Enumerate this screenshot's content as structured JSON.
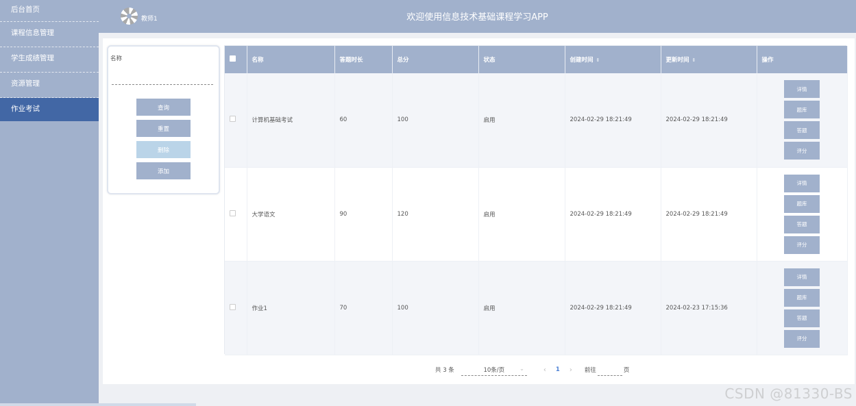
{
  "sidebar": {
    "items": [
      {
        "label": "后台首页"
      },
      {
        "label": "课程信息管理"
      },
      {
        "label": "学生成绩管理"
      },
      {
        "label": "资源管理"
      },
      {
        "label": "作业考试"
      }
    ]
  },
  "header": {
    "username": "教师1",
    "title": "欢迎使用信息技术基础课程学习APP"
  },
  "search": {
    "label": "名称",
    "value": "",
    "buttons": {
      "query": "查询",
      "reset": "重置",
      "delete": "删除",
      "add": "添加"
    }
  },
  "table": {
    "columns": {
      "name": "名称",
      "duration": "答题时长",
      "score": "总分",
      "status": "状态",
      "created": "创建时间",
      "updated": "更新时间",
      "actions": "操作"
    },
    "sort_icon": "⇕",
    "rows": [
      {
        "name": "计算机基础考试",
        "duration": "60",
        "score": "100",
        "status": "启用",
        "created": "2024-02-29 18:21:49",
        "updated": "2024-02-29 18:21:49"
      },
      {
        "name": "大学语文",
        "duration": "90",
        "score": "120",
        "status": "启用",
        "created": "2024-02-29 18:21:49",
        "updated": "2024-02-29 18:21:49"
      },
      {
        "name": "作业1",
        "duration": "70",
        "score": "100",
        "status": "启用",
        "created": "2024-02-29 18:21:49",
        "updated": "2024-02-23 17:15:36"
      }
    ],
    "row_actions": {
      "detail": "详情",
      "question_bank": "题库",
      "answer": "答题",
      "grade": "评分"
    }
  },
  "pagination": {
    "total": "共 3 条",
    "page_size": "10条/页",
    "current_page": "1",
    "goto_prefix": "前往",
    "goto_suffix": "页",
    "prev_icon": "‹",
    "next_icon": "›",
    "caret_icon": "⌄"
  },
  "watermark": "CSDN @81330-BS",
  "colors": {
    "primary": "#a1b1cc",
    "active_nav": "#4267a5",
    "disabled_button": "#bad4e8",
    "page_link": "#4a7fd4"
  }
}
